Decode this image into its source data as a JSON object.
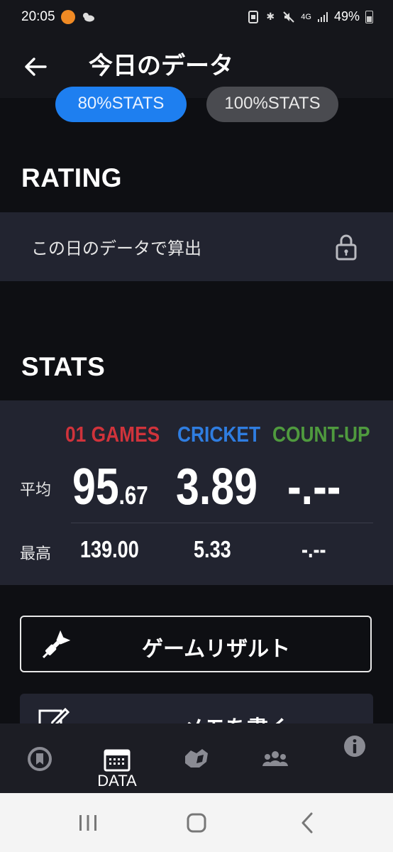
{
  "status_bar": {
    "time": "20:05",
    "network": "4G",
    "battery": "49%",
    "icons": [
      "app-notification-icon",
      "weather-icon",
      "nfc-icon",
      "bluetooth-icon",
      "mute-icon",
      "signal-icon",
      "battery-icon"
    ]
  },
  "header": {
    "title": "今日のデータ",
    "back_icon": "arrow-left-icon"
  },
  "filters": {
    "pill_80": "80%STATS",
    "pill_100": "100%STATS",
    "active": "80%STATS"
  },
  "rating": {
    "heading": "RATING",
    "row_text": "この日のデータで算出",
    "lock_icon": "lock-icon"
  },
  "stats": {
    "heading": "STATS",
    "columns": [
      {
        "name": "01 GAMES",
        "color": "#d0333b",
        "avg_int": "95",
        "avg_dec": ".67",
        "max": "139.00"
      },
      {
        "name": "CRICKET",
        "color": "#2f7de0",
        "avg_int": "3.89",
        "avg_dec": "",
        "max": "5.33"
      },
      {
        "name": "COUNT-UP",
        "color": "#4f9a3e",
        "avg_int": "-.--",
        "avg_dec": "",
        "max": "-.--"
      }
    ],
    "avg_label": "平均",
    "max_label": "最高"
  },
  "actions": {
    "game_result": "ゲームリザルト",
    "memo": "メモを書く"
  },
  "bottom_nav": {
    "items": [
      {
        "icon": "home-icon",
        "label": ""
      },
      {
        "icon": "data-icon",
        "label": "DATA",
        "active": true
      },
      {
        "icon": "region-icon",
        "label": ""
      },
      {
        "icon": "friends-icon",
        "label": ""
      },
      {
        "icon": "info-icon",
        "label": ""
      }
    ]
  },
  "system_nav": [
    "recents-button",
    "home-button",
    "back-button"
  ]
}
